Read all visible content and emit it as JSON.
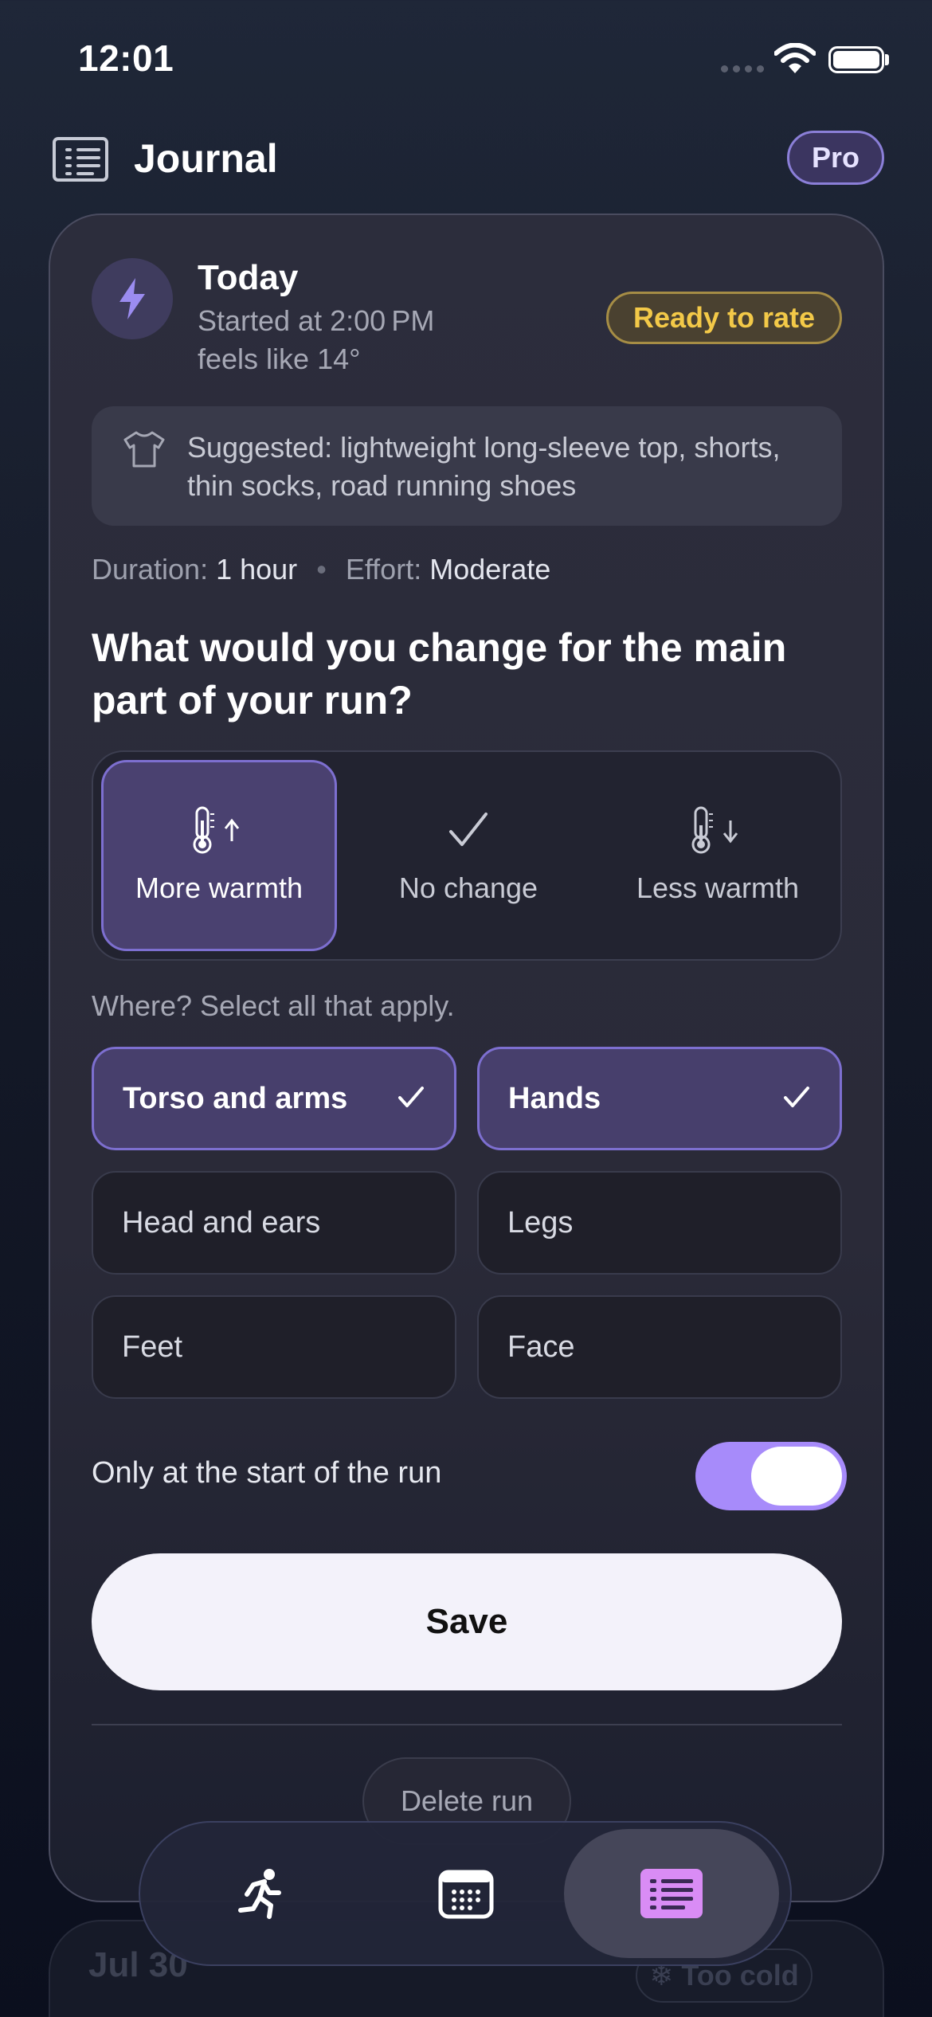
{
  "status_bar": {
    "time": "12:01"
  },
  "header": {
    "title": "Journal",
    "pro_label": "Pro"
  },
  "run": {
    "title": "Today",
    "started": "Started at 2:00 PM",
    "feels_like": "feels like 14°",
    "badge": "Ready to rate",
    "suggestion": "Suggested: lightweight long-sleeve top, shorts, thin socks, road running shoes",
    "duration_label": "Duration:",
    "duration_value": "1 hour",
    "effort_label": "Effort:",
    "effort_value": "Moderate"
  },
  "question": "What would you change for the main part of your run?",
  "options": [
    {
      "label": "More warmth",
      "icon": "thermometer-up-icon",
      "selected": true
    },
    {
      "label": "No change",
      "icon": "checkmark-icon",
      "selected": false
    },
    {
      "label": "Less warmth",
      "icon": "thermometer-down-icon",
      "selected": false
    }
  ],
  "where_label": "Where? Select all that apply.",
  "areas": [
    {
      "label": "Torso and arms",
      "selected": true
    },
    {
      "label": "Hands",
      "selected": true
    },
    {
      "label": "Head and ears",
      "selected": false
    },
    {
      "label": "Legs",
      "selected": false
    },
    {
      "label": "Feet",
      "selected": false
    },
    {
      "label": "Face",
      "selected": false
    }
  ],
  "toggle": {
    "label": "Only at the start of the run",
    "on": true
  },
  "save_label": "Save",
  "delete_label": "Delete run",
  "next_entry": {
    "date": "Jul 30",
    "badge": "Too cold"
  },
  "tabbar": {
    "tabs": [
      {
        "icon": "runner-icon",
        "active": false
      },
      {
        "icon": "calendar-icon",
        "active": false
      },
      {
        "icon": "journal-icon",
        "active": true
      }
    ]
  },
  "colors": {
    "accent": "#a78bfa",
    "selected_fill": "#473f6c",
    "badge_yellow": "#f3c948",
    "card": "#2a2a38"
  }
}
